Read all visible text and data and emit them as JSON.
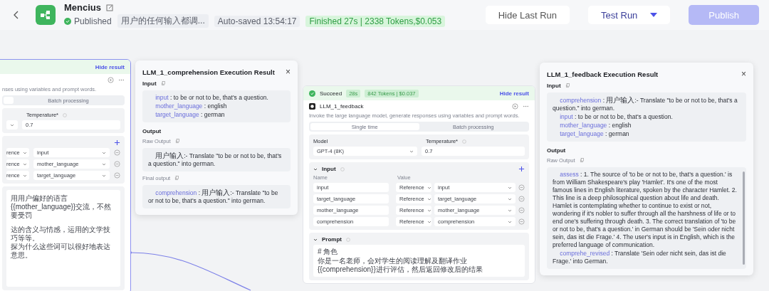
{
  "header": {
    "app_name": "Mencius",
    "status": "Published",
    "description": "用户的任何输入都调...",
    "autosave": "Auto-saved 13:54:17",
    "run_summary": "Finished 27s | 2338 Tokens,$0.053",
    "buttons": [
      {
        "label": "Hide Last Run",
        "kind": "plain",
        "disabled": false
      },
      {
        "label": "Test Run",
        "kind": "split",
        "disabled": false
      },
      {
        "label": "Publish",
        "kind": "primary",
        "disabled": true
      }
    ]
  },
  "left_node": {
    "hide_result": "Hide result",
    "description": "nses using variables and prompt words.",
    "tabs": [
      {
        "label": "Batch processing",
        "selected": false
      }
    ],
    "temperature_label": "Temperature*",
    "temperature": "0.7",
    "inputs": [
      {
        "type": "rence",
        "value": "input"
      },
      {
        "type": "rence",
        "value": "mother_language"
      },
      {
        "type": "rence",
        "value": "target_language"
      }
    ],
    "prompt_paragraphs": [
      [
        "用用户偏好的语言{{mother_language}}交流，不然要受罚"
      ],
      [
        "达的含义与情感，运用的文学技巧等等。",
        "探为什么这些词可以很好地表达意思。"
      ]
    ]
  },
  "feedback_node": {
    "status": "Succeed",
    "duration": "28s",
    "cost": "842 Tokens | $0.037",
    "hide_result": "Hide result",
    "title": "LLM_1_feedback",
    "description": "Invoke the large language model, generate responses using variables and prompt words.",
    "tabs": [
      {
        "label": "Single time",
        "selected": true
      },
      {
        "label": "Batch processing",
        "selected": false
      }
    ],
    "model_label": "Model",
    "model": "GPT-4 (8K)",
    "temperature_label": "Temperature*",
    "temperature": "0.7",
    "input_title": "Input",
    "columns": [
      "Name",
      "Value"
    ],
    "inputs": [
      {
        "name": "input",
        "type": "Reference",
        "value": "input"
      },
      {
        "name": "target_language",
        "type": "Reference",
        "value": "target_language"
      },
      {
        "name": "mother_language",
        "type": "Reference",
        "value": "mother_language"
      },
      {
        "name": "comprehension",
        "type": "Reference",
        "value": "comprehension"
      }
    ],
    "prompt_title": "Prompt",
    "prompt_lines": [
      "# 角色",
      "你是一名老师，会对学生的阅读理解及翻译作业{{comprehension}}进行评估，然后返回修改后的结果"
    ]
  },
  "result_panels": [
    {
      "title": "LLM_1_comprehension Execution Result",
      "close": "×",
      "separator": ":",
      "input_label": "Input",
      "inputs": [
        {
          "key": "input",
          "value": "to be or not to be, that's a question."
        },
        {
          "key": "mother_language",
          "value": "english"
        },
        {
          "key": "target_language",
          "value": "german"
        }
      ],
      "output_label": "Output",
      "outputs": [
        {
          "label": "Raw Output",
          "scrollbar": false,
          "entries": [
            {
              "value": "用户输入:- Translate \"to be or not to be, that's a question.\" into german."
            }
          ]
        },
        {
          "label": "Final output",
          "scrollbar": false,
          "entries": [
            {
              "key": "comprehension",
              "value": "用户输入:- Translate \"to be or not to be, that's a question.\" into german."
            }
          ]
        }
      ]
    },
    {
      "title": "LLM_1_feedback Execution Result",
      "close": "×",
      "separator": ":",
      "input_label": "Input",
      "inputs": [
        {
          "key": "comprehension",
          "value": "用户输入:- Translate \"to be or not to be, that's a question.\" into german."
        },
        {
          "key": "input",
          "value": "to be or not to be, that's a question."
        },
        {
          "key": "mother_language",
          "value": "english"
        },
        {
          "key": "target_language",
          "value": "german"
        }
      ],
      "output_label": "Output",
      "outputs": [
        {
          "label": "Raw Output",
          "scrollbar": true,
          "entries": [
            {
              "key": "assess",
              "value": "1. The source of 'to be or not to be, that's a question.' is from William Shakespeare's play 'Hamlet'. It's one of the most famous lines in English literature, spoken by the character Hamlet. 2. This line is a deep philosophical question about life and death. Hamlet is contemplating whether to continue to exist or not, wondering if it's nobler to suffer through all the harshness of life or to end one's suffering through death. 3. The correct translation of 'to be or not to be, that's a question.' in German should be 'Sein oder nicht sein, das ist die Frage.' 4. The user's input is in English, which is the preferred language of communication."
            },
            {
              "key": "comprehe_revised",
              "value": "Translate 'Sein oder nicht sein, das ist die Frage.' into German."
            }
          ]
        }
      ]
    }
  ]
}
